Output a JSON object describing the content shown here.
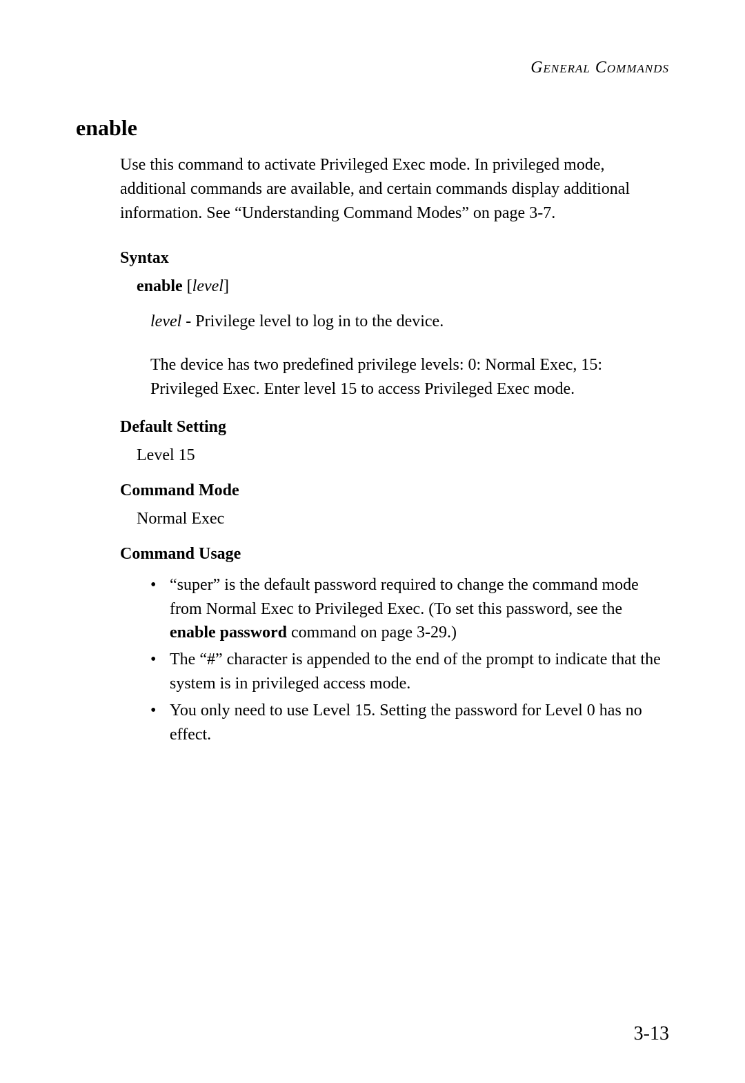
{
  "header": {
    "title": "General Commands"
  },
  "command": {
    "title": "enable",
    "description": "Use this command to activate Privileged Exec mode. In privileged mode, additional commands are available, and certain commands display additional information. See “Understanding Command Modes” on page 3-7."
  },
  "syntax": {
    "heading": "Syntax",
    "command": "enable",
    "bracket_open": " [",
    "param": "level",
    "bracket_close": "]",
    "param_desc_name": "level",
    "param_desc_text": " - Privilege level to log in to the device.",
    "note": "The device has two predefined privilege levels: 0: Normal Exec, 15: Privileged Exec. Enter level 15 to access Privileged Exec mode."
  },
  "default_setting": {
    "heading": "Default Setting",
    "value": "Level 15"
  },
  "command_mode": {
    "heading": "Command Mode",
    "value": "Normal Exec"
  },
  "command_usage": {
    "heading": "Command Usage",
    "items": [
      {
        "pre": "“super” is the default password required to change the command mode from Normal Exec to Privileged Exec. (To set this password, see the ",
        "bold": "enable password",
        "post": " command on page 3-29.)"
      },
      {
        "pre": "The “#” character is appended to the end of the prompt to indicate that the system is in privileged access mode.",
        "bold": "",
        "post": ""
      },
      {
        "pre": "You only need to use Level 15. Setting the password for Level 0 has no effect.",
        "bold": "",
        "post": ""
      }
    ]
  },
  "page_number": "3-13"
}
